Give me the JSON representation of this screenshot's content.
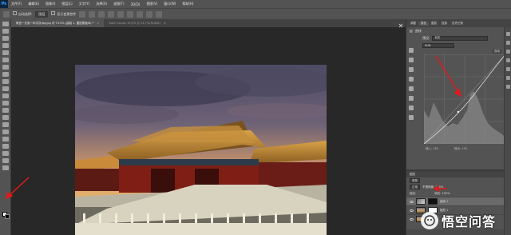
{
  "app": {
    "logo_text": "Ps"
  },
  "menu": [
    "文件(F)",
    "编辑(E)",
    "图像(I)",
    "图层(L)",
    "文字(Y)",
    "选择(S)",
    "滤镜(T)",
    "3D(D)",
    "视图(V)",
    "窗口(W)",
    "帮助(H)"
  ],
  "options_bar": {
    "auto_select_label": "自动选择:",
    "auto_select_value": "图层",
    "show_transform_label": "显示变换控件"
  },
  "tabs": [
    {
      "label": "故宫一天到一年次次(bg.jpg @ 73.5% (曲线 1, 图层蒙版/8) *",
      "active": true
    },
    {
      "label": "Swift Clouds 19.JPG @ 24.7%(RGB/8)",
      "active": false
    }
  ],
  "properties": {
    "tabs": [
      "调整",
      "属性",
      "图层",
      "信息",
      "历史记录"
    ],
    "title": "曲线",
    "preset_label": "预设:",
    "preset_value": "自定",
    "channel_value": "RGB",
    "auto_label": "自动",
    "input_label": "输入: 163",
    "output_label": "输出: 150"
  },
  "layers": {
    "tab_label": "图层",
    "kind_label": "类型",
    "blend_mode": "正常",
    "opacity_label": "不透明度: 100%",
    "lock_label": "锁定:",
    "fill_label": "填充: 100%",
    "items": [
      {
        "name": "曲线 1",
        "selected": true
      },
      {
        "name": "图层 1",
        "selected": false
      },
      {
        "name": "图层 0",
        "selected": false
      }
    ]
  },
  "watermark": {
    "text": "悟空问答"
  },
  "colors": {
    "accent_red": "#e01a1a",
    "ps_blue": "#31a8ff"
  }
}
